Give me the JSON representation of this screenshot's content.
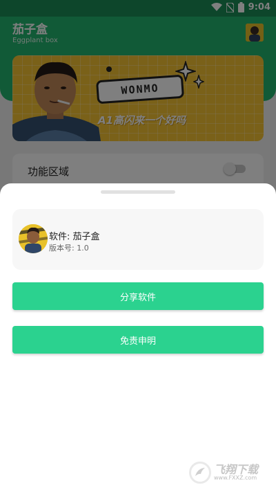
{
  "status_bar": {
    "time": "9:04",
    "icons": [
      "wifi-icon",
      "no-sim-icon",
      "battery-icon"
    ]
  },
  "header": {
    "title": "茄子盒",
    "subtitle": "Eggplant box",
    "avatar": "avatar-thumbnail"
  },
  "banner": {
    "badge_text": "WONMO",
    "slogan": "A1高闪来一个好吗"
  },
  "function_area": {
    "label": "功能区域",
    "toggle_on": false
  },
  "sheet": {
    "app_name": "软件: 茄子盒",
    "version": "版本号: 1.0",
    "share_button": "分享软件",
    "disclaimer_button": "免责申明"
  },
  "watermark": {
    "text": "飞翔下载",
    "url": "www.FXXZ.com"
  },
  "colors": {
    "header": "#23b46e",
    "button": "#2bd28f",
    "banner": "#f5c233"
  }
}
